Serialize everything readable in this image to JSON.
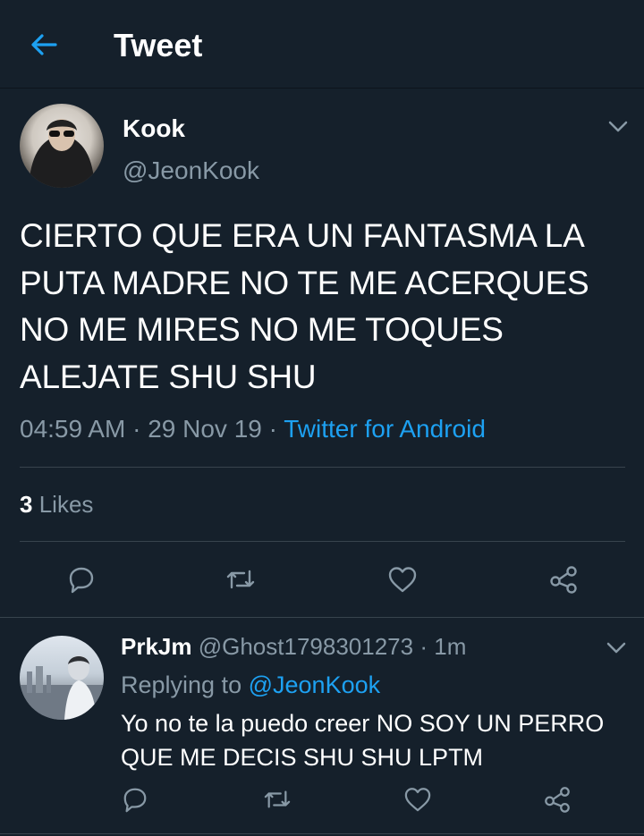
{
  "header": {
    "title": "Tweet",
    "back_icon": "arrow-left-icon"
  },
  "colors": {
    "background": "#15202b",
    "accent": "#1da1f2",
    "muted": "#8899a6",
    "divider": "#38444d"
  },
  "tweet": {
    "display_name": "Kook",
    "handle": "@JeonKook",
    "text_lines": [
      "CIERTO QUE ERA UN FANTASMA LA",
      "PUTA MADRE NO TE ME ACERQUES",
      "NO ME MIRES NO ME TOQUES",
      "ALEJATE SHU SHU"
    ],
    "time": "04:59 AM",
    "date": "29 Nov 19",
    "separator": "·",
    "source": "Twitter for Android",
    "likes_count": "3",
    "likes_label": "Likes"
  },
  "reply": {
    "display_name": "PrkJm",
    "handle": "@Ghost1798301273",
    "age": "1m",
    "separator": "·",
    "replying_prefix": "Replying to",
    "replying_to": "@JeonKook",
    "text_lines": [
      "Yo no te la puedo creer NO SOY UN PERRO",
      "QUE ME DECIS SHU SHU LPTM"
    ]
  },
  "actions": [
    "reply-icon",
    "retweet-icon",
    "like-icon",
    "share-icon"
  ]
}
